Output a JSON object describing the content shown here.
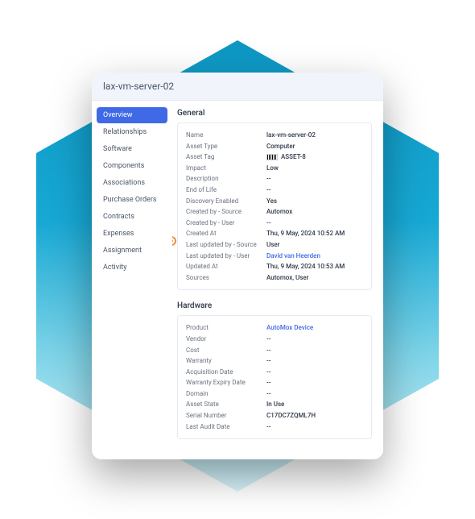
{
  "header": {
    "title": "lax-vm-server-02"
  },
  "sidebar": {
    "items": [
      {
        "label": "Overview",
        "active": true
      },
      {
        "label": "Relationships",
        "active": false
      },
      {
        "label": "Software",
        "active": false
      },
      {
        "label": "Components",
        "active": false
      },
      {
        "label": "Associations",
        "active": false
      },
      {
        "label": "Purchase Orders",
        "active": false
      },
      {
        "label": "Contracts",
        "active": false
      },
      {
        "label": "Expenses",
        "active": false
      },
      {
        "label": "Assignment",
        "active": false
      },
      {
        "label": "Activity",
        "active": false
      }
    ]
  },
  "sections": {
    "general": {
      "title": "General",
      "rows": [
        {
          "label": "Name",
          "value": "lax-vm-server-02"
        },
        {
          "label": "Asset Type",
          "value": "Computer"
        },
        {
          "label": "Asset Tag",
          "value": "ASSET-8",
          "barcode": true
        },
        {
          "label": "Impact",
          "value": "Low"
        },
        {
          "label": "Description",
          "value": "--"
        },
        {
          "label": "End of Life",
          "value": "--"
        },
        {
          "label": "Discovery Enabled",
          "value": "Yes"
        },
        {
          "label": "Created by - Source",
          "value": "Automox"
        },
        {
          "label": "Created by - User",
          "value": "--"
        },
        {
          "label": "Created At",
          "value": "Thu, 9 May, 2024 10:52 AM"
        },
        {
          "label": "Last updated by - Source",
          "value": "User"
        },
        {
          "label": "Last updated by - User",
          "value": "David van Heerden",
          "link": true
        },
        {
          "label": "Updated At",
          "value": "Thu, 9 May, 2024 10:53 AM"
        },
        {
          "label": "Sources",
          "value": "Automox, User"
        }
      ]
    },
    "hardware": {
      "title": "Hardware",
      "rows": [
        {
          "label": "Product",
          "value": "AutoMox Device",
          "link": true
        },
        {
          "label": "Vendor",
          "value": "--"
        },
        {
          "label": "Cost",
          "value": "--"
        },
        {
          "label": "Warranty",
          "value": "--"
        },
        {
          "label": "Acquisition Date",
          "value": "--"
        },
        {
          "label": "Warranty Expiry Date",
          "value": "--"
        },
        {
          "label": "Domain",
          "value": "--"
        },
        {
          "label": "Asset State",
          "value": "In Use"
        },
        {
          "label": "Serial Number",
          "value": "C17DC7ZQML7H"
        },
        {
          "label": "Last Audit Date",
          "value": "--"
        }
      ]
    }
  }
}
